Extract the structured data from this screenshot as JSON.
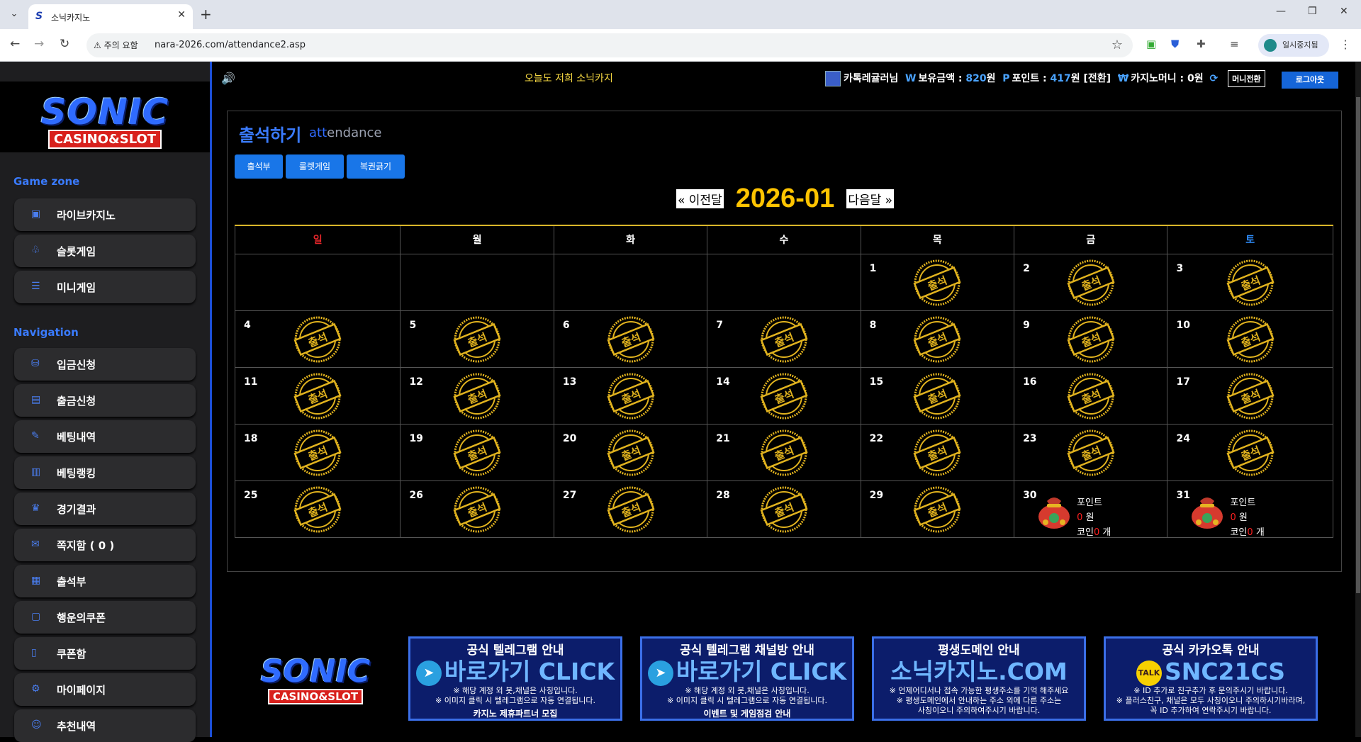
{
  "browser": {
    "tab_title": "소닉카지노",
    "tab_favicon": "S",
    "security_label": "주의 요함",
    "url": "nara-2026.com/attendance2.asp",
    "profile_label": "일시중지됨"
  },
  "topbar": {
    "marquee": "오늘도 저희 소닉카지",
    "username": "카톡레귤러님",
    "balance_label": "보유금액 :",
    "balance_value": "820",
    "balance_unit": "원",
    "point_label": "포인트 :",
    "point_value": "417",
    "point_unit": "원",
    "point_convert": "[전환]",
    "casino_money_label": "카지노머니 : 0원",
    "money_convert_button": "머니전환",
    "logout_button": "로그아웃"
  },
  "sidebar": {
    "logo_main": "SONIC",
    "logo_sub": "CASINO&SLOT",
    "gamezone_title": "Game zone",
    "gamezone_items": [
      {
        "label": "라이브카지노",
        "icon": "card-icon"
      },
      {
        "label": "슬롯게임",
        "icon": "slot-icon"
      },
      {
        "label": "미니게임",
        "icon": "list-icon"
      }
    ],
    "navigation_title": "Navigation",
    "navigation_items": [
      {
        "label": "입금신청",
        "icon": "deposit-icon"
      },
      {
        "label": "출금신청",
        "icon": "wallet-icon"
      },
      {
        "label": "베팅내역",
        "icon": "history-icon"
      },
      {
        "label": "베팅랭킹",
        "icon": "chart-icon"
      },
      {
        "label": "경기결과",
        "icon": "trophy-icon"
      },
      {
        "label": "쪽지함 ( 0 )",
        "icon": "message-icon"
      },
      {
        "label": "출석부",
        "icon": "calendar-icon"
      },
      {
        "label": "행운의쿠폰",
        "icon": "coupon-icon"
      },
      {
        "label": "쿠폰함",
        "icon": "box-icon"
      },
      {
        "label": "마이페이지",
        "icon": "gear-icon"
      },
      {
        "label": "추천내역",
        "icon": "user-icon"
      }
    ]
  },
  "main": {
    "title": "출석하기",
    "subtitle_a": "att",
    "subtitle_b": "endance",
    "tabs": [
      "출석부",
      "룰렛게임",
      "복권긁기"
    ],
    "prev_month": "« 이전달",
    "month_title": "2026-01",
    "next_month": "다음달 »",
    "weekdays": [
      "일",
      "월",
      "화",
      "수",
      "목",
      "금",
      "토"
    ],
    "stamp_text": "출석",
    "attended_days": [
      1,
      2,
      3,
      4,
      5,
      6,
      7,
      8,
      9,
      10,
      11,
      12,
      13,
      14,
      15,
      16,
      17,
      18,
      19,
      20,
      21,
      22,
      23,
      24,
      25,
      26,
      27,
      28,
      29
    ],
    "reward_days": [
      30,
      31
    ],
    "reward_point_label": "포인트",
    "reward_point_value": "0",
    "reward_point_unit": "원",
    "reward_coin_label": "코인",
    "reward_coin_value": "0",
    "reward_coin_unit": "개",
    "first_weekday": 4,
    "days_in_month": 31
  },
  "footer": {
    "logo_main": "SONIC",
    "logo_sub": "CASINO&SLOT",
    "banners": [
      {
        "title": "공식 텔레그램 안내",
        "main": "바로가기 CLICK",
        "icon": "telegram-icon",
        "lines": [
          "※ 해당 계정 외 봇,채널은 사칭입니다.",
          "※ 이미지 클릭 시 텔레그램으로 자동 연결됩니다."
        ],
        "foot": "카지노 제휴파트너 모집"
      },
      {
        "title": "공식 텔레그램 채널방 안내",
        "main": "바로가기 CLICK",
        "icon": "telegram-icon",
        "lines": [
          "※ 해당 계정 외 봇,채널은 사칭입니다.",
          "※ 이미지 클릭 시 텔레그램으로 자동 연결됩니다."
        ],
        "foot": "이벤트 및 게임점검 안내"
      },
      {
        "title": "평생도메인 안내",
        "main": "소닉카지노.COM",
        "icon": "",
        "lines": [
          "※ 언제어디서나 접속 가능한  평생주소를 기억 해주세요",
          "※ 평생도메인에서 안내하는 주소 외에 다른 주소는",
          "사칭이오니 주의하여주시기 바랍니다."
        ],
        "foot": ""
      },
      {
        "title": "공식 카카오톡 안내",
        "main": "SNC21CS",
        "icon": "kakao-talk-icon",
        "lines": [
          "※ ID 추가로 친구추가 후 문의주시기 바랍니다.",
          "※ 플러스친구, 채널은 모두 사칭이오니 주의하시기바라며,",
          "꼭 ID 추가하여 연락주시기 바랍니다."
        ],
        "foot": ""
      }
    ]
  },
  "colors": {
    "accent": "#1976e8",
    "gold": "#ffc400",
    "sunday": "#e3262a",
    "saturday": "#2f8fff"
  }
}
